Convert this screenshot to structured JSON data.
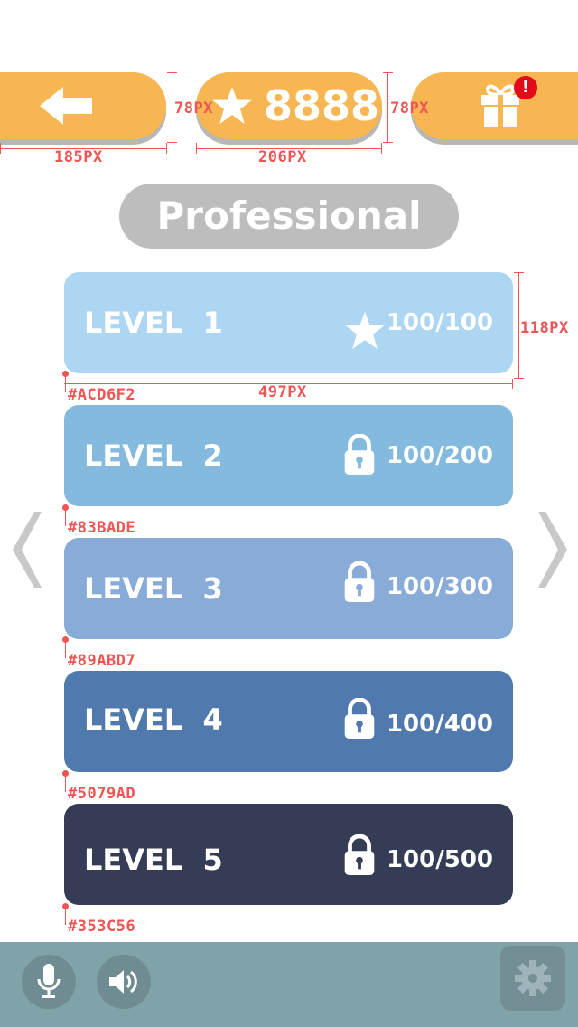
{
  "header": {
    "score": "8888",
    "back_label": "back",
    "gift_badge": "!"
  },
  "annotations": {
    "back_width": "185PX",
    "score_width": "206PX",
    "back_height": "78PX",
    "score_height": "78PX",
    "card_height": "118PX",
    "card_width": "497PX"
  },
  "title": "Professional",
  "levels": [
    {
      "label": "LEVEL  1",
      "score": "100/100",
      "icon": "star-icon",
      "color": "#ACD6F2",
      "color_label": "#ACD6F2"
    },
    {
      "label": "LEVEL  2",
      "score": "100/200",
      "icon": "lock-icon",
      "color": "#83BADE",
      "color_label": "#83BADE"
    },
    {
      "label": "LEVEL  3",
      "score": "100/300",
      "icon": "lock-icon",
      "color": "#89ABD7",
      "color_label": "#89ABD7"
    },
    {
      "label": "LEVEL  4",
      "score": "100/400",
      "icon": "lock-icon",
      "color": "#5079AD",
      "color_label": "#5079AD"
    },
    {
      "label": "LEVEL  5",
      "score": "100/500",
      "icon": "lock-icon",
      "color": "#353C56",
      "color_label": "#353C56"
    }
  ],
  "colors": {
    "accent": "#f7b652",
    "annotation": "#f05454",
    "bottom_bar": "#7fa3a8"
  }
}
